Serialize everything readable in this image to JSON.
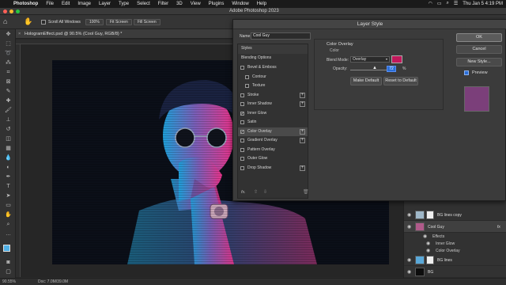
{
  "menubar": {
    "items": [
      "Photoshop",
      "File",
      "Edit",
      "Image",
      "Layer",
      "Type",
      "Select",
      "Filter",
      "3D",
      "View",
      "Plugins",
      "Window",
      "Help"
    ],
    "datetime": "Thu Jan 5  4:19 PM"
  },
  "app_title": "Adobe Photoshop 2023",
  "options": {
    "scroll_all": "Scroll All Windows",
    "zoom": "100%",
    "fit_screen": "Fit Screen",
    "fill_screen": "Fill Screen"
  },
  "document_tab": "HologramEffect.psd @ 90.5% (Cool Guy, RGB/8) *",
  "status": {
    "zoom": "90.55%",
    "doc": "Doc: 7.0M/39.0M"
  },
  "dialog": {
    "title": "Layer Style",
    "name_label": "Name:",
    "name_value": "Cool Guy",
    "styles_header": "Styles",
    "blending_options": "Blending Options",
    "style_items": [
      {
        "label": "Bevel & Emboss",
        "checked": false,
        "plus": false
      },
      {
        "label": "Contour",
        "checked": false,
        "plus": false,
        "indent": true
      },
      {
        "label": "Texture",
        "checked": false,
        "plus": false,
        "indent": true
      },
      {
        "label": "Stroke",
        "checked": false,
        "plus": true
      },
      {
        "label": "Inner Shadow",
        "checked": false,
        "plus": true
      },
      {
        "label": "Inner Glow",
        "checked": true,
        "plus": false
      },
      {
        "label": "Satin",
        "checked": false,
        "plus": false
      },
      {
        "label": "Color Overlay",
        "checked": true,
        "plus": true,
        "selected": true
      },
      {
        "label": "Gradient Overlay",
        "checked": false,
        "plus": true
      },
      {
        "label": "Pattern Overlay",
        "checked": false,
        "plus": false
      },
      {
        "label": "Outer Glow",
        "checked": false,
        "plus": false
      },
      {
        "label": "Drop Shadow",
        "checked": false,
        "plus": true
      }
    ],
    "fx_label": "fx.",
    "section_title": "Color Overlay",
    "section_sub": "Color",
    "blend_mode_label": "Blend Mode:",
    "blend_mode_value": "Overlay",
    "opacity_label": "Opacity:",
    "opacity_value": "72",
    "opacity_unit": "%",
    "overlay_color": "#c2185b",
    "make_default": "Make Default",
    "reset_default": "Reset to Default",
    "ok": "OK",
    "cancel": "Cancel",
    "new_style": "New Style...",
    "preview_label": "Preview",
    "preview_color": "#7b3f7a"
  },
  "layers": [
    {
      "name": "BG lines copy",
      "thumb": "#9fb7c8"
    },
    {
      "name": "Cool Guy",
      "thumb": "#b05a8a",
      "selected": true,
      "fx": "fx"
    },
    {
      "name": "Effects",
      "sub": true
    },
    {
      "name": "Inner Glow",
      "sub": true
    },
    {
      "name": "Color Overlay",
      "sub": true
    },
    {
      "name": "BG lines",
      "thumb": "#5aa8d8"
    },
    {
      "name": "BG",
      "thumb": "#0d0d0d"
    }
  ]
}
